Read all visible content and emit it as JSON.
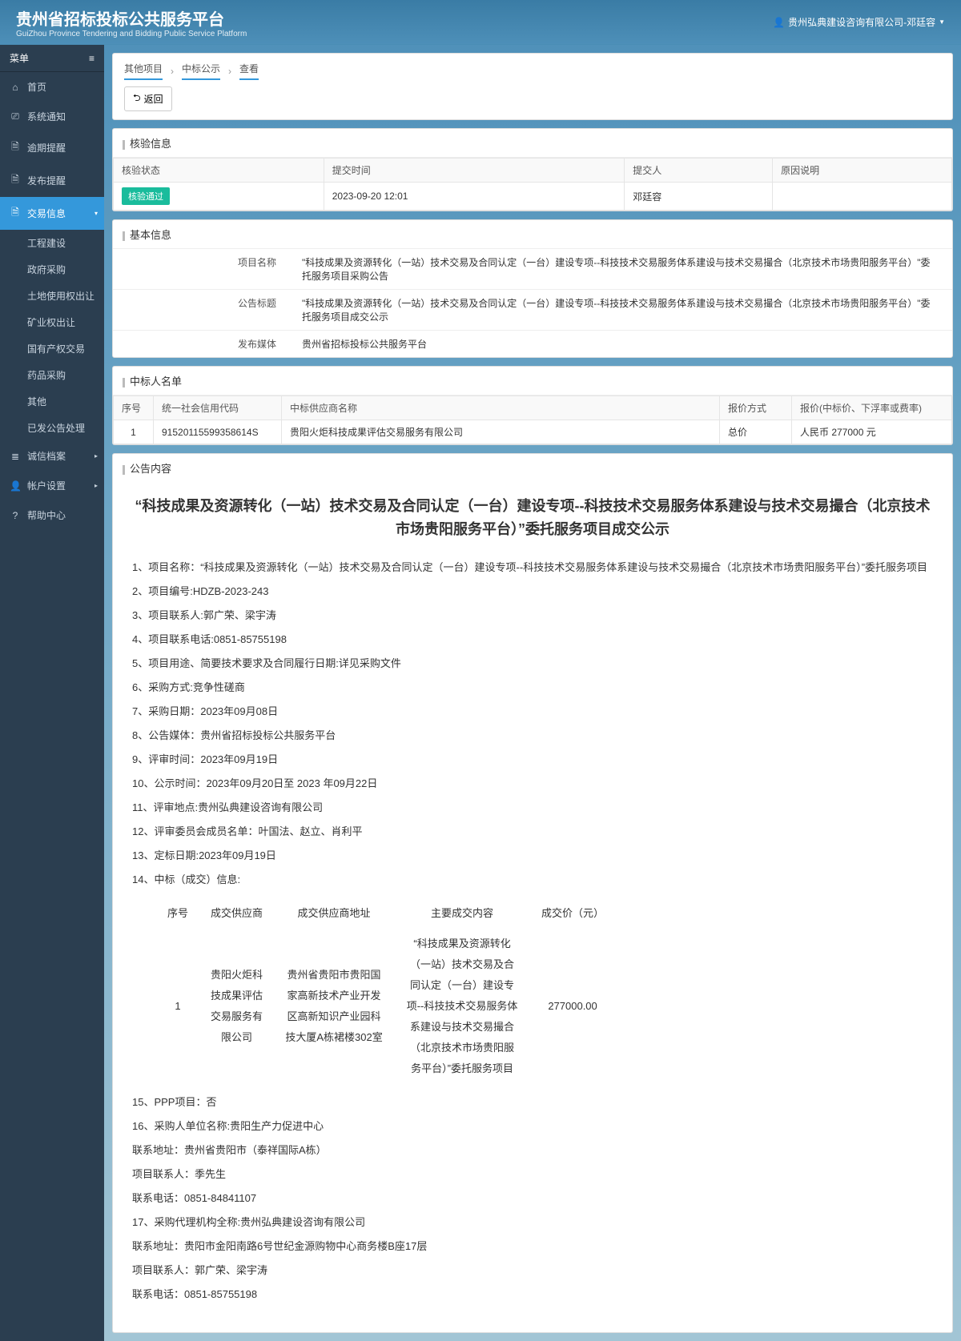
{
  "header": {
    "title_zh": "贵州省招标投标公共服务平台",
    "title_en": "GuiZhou Province Tendering and Bidding Public Service Platform",
    "user": "贵州弘典建设咨询有限公司-邓廷容"
  },
  "sidebar": {
    "menu_label": "菜单",
    "items": [
      {
        "icon": "⌂",
        "label": "首页"
      },
      {
        "icon": "⎚",
        "label": "系统通知"
      },
      {
        "icon": "🗎",
        "label": "逾期提醒"
      },
      {
        "icon": "🗎",
        "label": "发布提醒"
      },
      {
        "icon": "🗎",
        "label": "交易信息",
        "active": true,
        "arrow": "▾"
      },
      {
        "icon": "≣",
        "label": "诚信档案",
        "arrow": "▸"
      },
      {
        "icon": "👤",
        "label": "帐户设置",
        "arrow": "▸"
      },
      {
        "icon": "?",
        "label": "帮助中心"
      }
    ],
    "sub_items": [
      "工程建设",
      "政府采购",
      "土地使用权出让",
      "矿业权出让",
      "国有产权交易",
      "药品采购",
      "其他",
      "已发公告处理"
    ]
  },
  "breadcrumb": [
    "其他项目",
    "中标公示",
    "查看"
  ],
  "back_label": "返回",
  "verify": {
    "title": "核验信息",
    "headers": [
      "核验状态",
      "提交时间",
      "提交人",
      "原因说明"
    ],
    "row": {
      "status": "核验通过",
      "time": "2023-09-20 12:01",
      "user": "邓廷容",
      "reason": ""
    }
  },
  "basic": {
    "title": "基本信息",
    "rows": [
      {
        "label": "项目名称",
        "value": "\"科技成果及资源转化（一站）技术交易及合同认定（一台）建设专项--科技技术交易服务体系建设与技术交易撮合（北京技术市场贵阳服务平台）\"委托服务项目采购公告"
      },
      {
        "label": "公告标题",
        "value": "\"科技成果及资源转化（一站）技术交易及合同认定（一台）建设专项--科技技术交易服务体系建设与技术交易撮合（北京技术市场贵阳服务平台）\"委托服务项目成交公示"
      },
      {
        "label": "发布媒体",
        "value": "贵州省招标投标公共服务平台"
      }
    ]
  },
  "winner": {
    "title": "中标人名单",
    "headers": [
      "序号",
      "统一社会信用代码",
      "中标供应商名称",
      "报价方式",
      "报价(中标价、下浮率或费率)"
    ],
    "row": {
      "no": "1",
      "code": "91520115599358614S",
      "name": "贵阳火炬科技成果评估交易服务有限公司",
      "method": "总价",
      "price": "人民币 277000 元"
    }
  },
  "notice": {
    "section_title": "公告内容",
    "title": "“科技成果及资源转化（一站）技术交易及合同认定（一台）建设专项--科技技术交易服务体系建设与技术交易撮合（北京技术市场贵阳服务平台）”委托服务项目成交公示",
    "lines": [
      "1、项目名称：“科技成果及资源转化（一站）技术交易及合同认定（一台）建设专项--科技技术交易服务体系建设与技术交易撮合（北京技术市场贵阳服务平台）”委托服务项目",
      "2、项目编号:HDZB-2023-243",
      "3、项目联系人:郭广荣、梁宇涛",
      "4、项目联系电话:0851-85755198",
      "5、项目用途、简要技术要求及合同履行日期:详见采购文件",
      "6、采购方式:竞争性磋商",
      "7、采购日期：2023年09月08日",
      "8、公告媒体：贵州省招标投标公共服务平台",
      "9、评审时间：2023年09月19日",
      "10、公示时间：2023年09月20日至 2023 年09月22日",
      "11、评审地点:贵州弘典建设咨询有限公司",
      "12、评审委员会成员名单：叶国法、赵立、肖利平",
      "13、定标日期:2023年09月19日",
      "14、中标（成交）信息:"
    ],
    "deal": {
      "headers": [
        "序号",
        "成交供应商",
        "成交供应商地址",
        "主要成交内容",
        "成交价（元）"
      ],
      "row": {
        "no": "1",
        "supplier": "贵阳火炬科技成果评估交易服务有限公司",
        "addr": "贵州省贵阳市贵阳国家高新技术产业开发区高新知识产业园科技大厦A栋裙楼302室",
        "content": "“科技成果及资源转化（一站）技术交易及合同认定（一台）建设专项--科技技术交易服务体系建设与技术交易撮合（北京技术市场贵阳服务平台）”委托服务项目",
        "price": "277000.00"
      }
    },
    "lines2": [
      "15、PPP项目：否",
      "16、采购人单位名称:贵阳生产力促进中心",
      "联系地址：贵州省贵阳市（泰祥国际A栋）",
      "项目联系人：季先生",
      "联系电话：0851-84841107",
      "17、采购代理机构全称:贵州弘典建设咨询有限公司",
      "联系地址：贵阳市金阳南路6号世纪金源购物中心商务楼B座17层",
      "项目联系人：郭广荣、梁宇涛",
      "联系电话：0851-85755198"
    ]
  }
}
